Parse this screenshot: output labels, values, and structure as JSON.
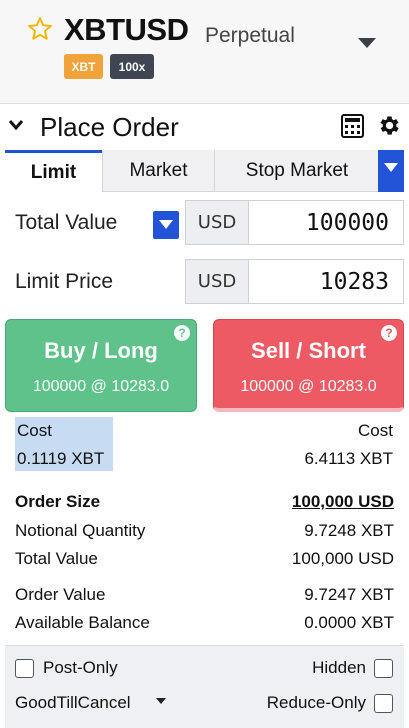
{
  "instrument": {
    "symbol": "XBTUSD",
    "contract_type": "Perpetual",
    "badges": {
      "currency": "XBT",
      "leverage": "100x"
    }
  },
  "place_order": {
    "title": "Place Order",
    "tabs": [
      {
        "label": "Limit",
        "active": true
      },
      {
        "label": "Market",
        "active": false
      },
      {
        "label": "Stop Market",
        "active": false
      }
    ],
    "total_value": {
      "label": "Total Value",
      "unit": "USD",
      "value": "100000"
    },
    "limit_price": {
      "label": "Limit Price",
      "unit": "USD",
      "value": "10283"
    },
    "buy_button": {
      "title": "Buy / Long",
      "subtitle": "100000 @ 10283.0",
      "help": "?"
    },
    "sell_button": {
      "title": "Sell / Short",
      "subtitle": "100000 @ 10283.0",
      "help": "?"
    },
    "cost": {
      "buy_label": "Cost",
      "buy_value": "0.1119 XBT",
      "sell_label": "Cost",
      "sell_value": "6.4113 XBT"
    },
    "summary": {
      "order_size_label": "Order Size",
      "order_size_value": "100,000 USD",
      "notional_label": "Notional Quantity",
      "notional_value": "9.7248 XBT",
      "total_value_label": "Total Value",
      "total_value_value": "100,000 USD",
      "order_value_label": "Order Value",
      "order_value_value": "9.7247 XBT",
      "balance_label": "Available Balance",
      "balance_value": "0.0000 XBT"
    },
    "options": {
      "post_only": "Post-Only",
      "hidden": "Hidden",
      "time_in_force": "GoodTillCancel",
      "reduce_only": "Reduce-Only"
    }
  },
  "colors": {
    "accent": "#2353d6",
    "buy": "#5fc28a",
    "sell": "#ee5a63",
    "badge_currency": "#f0a23b",
    "badge_leverage": "#3d4652",
    "cost_highlight": "#c7dcf3"
  }
}
